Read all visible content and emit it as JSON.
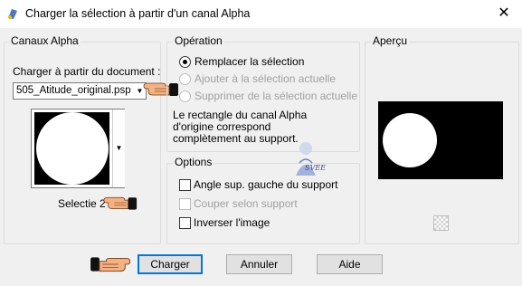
{
  "window": {
    "title": "Charger la sélection à partir d'un canal Alpha",
    "close_label": "✕"
  },
  "canaux": {
    "legend": "Canaux Alpha",
    "charger_label": "Charger à partir du document :",
    "document_value": "505_Atitude_original.psp",
    "selectie_label": "Selectie 2"
  },
  "operation": {
    "legend": "Opération",
    "options": [
      {
        "label": "Remplacer la sélection",
        "selected": true,
        "enabled": true
      },
      {
        "label": "Ajouter à la sélection actuelle",
        "selected": false,
        "enabled": false
      },
      {
        "label": "Supprimer de la sélection actuelle",
        "selected": false,
        "enabled": false
      }
    ],
    "description": [
      "Le rectangle du canal Alpha",
      "d'origine correspond",
      "complètement au support."
    ]
  },
  "options": {
    "legend": "Options",
    "items": [
      {
        "label": "Angle sup. gauche du support",
        "checked": false,
        "enabled": true
      },
      {
        "label": "Couper selon support",
        "checked": false,
        "enabled": false
      },
      {
        "label": "Inverser l'image",
        "checked": false,
        "enabled": true
      }
    ]
  },
  "apercu": {
    "legend": "Aperçu"
  },
  "buttons": {
    "charger": "Charger",
    "annuler": "Annuler",
    "aide": "Aide"
  },
  "colors": {
    "accent": "#0078d7",
    "disabled_text": "#a0a0a0",
    "preview_bg": "#000000",
    "hand_skin": "#f4b183"
  },
  "watermark_text": "SVEE"
}
